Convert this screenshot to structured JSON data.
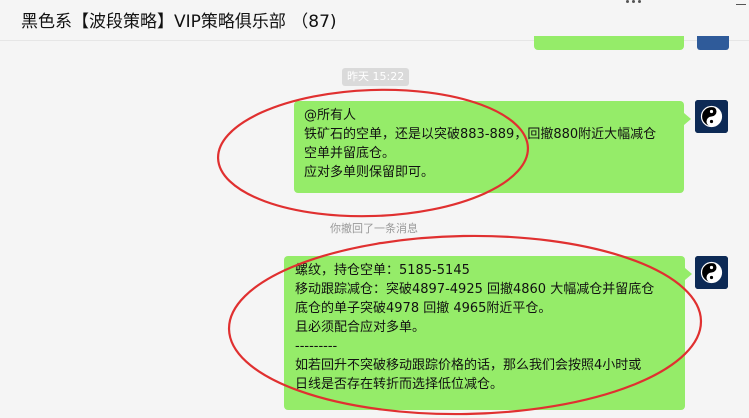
{
  "header": {
    "title": "黑色系【波段策略】VIP策略俱乐部 （87)"
  },
  "timestamp": "昨天 15:22",
  "recall_notice": "你撤回了一条消息",
  "messages": [
    {
      "lines": [
        "@所有人",
        "铁矿石的空单，还是以突破883-889，回撤880附近大幅减仓",
        "空单并留底仓。",
        "应对多单则保留即可。"
      ]
    },
    {
      "lines": [
        "螺纹，持仓空单：5185-5145",
        "移动跟踪减仓：突破4897-4925  回撤4860 大幅减仓并留底仓",
        "底仓的单子突破4978 回撤 4965附近平仓。",
        "且必须配合应对多单。",
        "---------",
        "如若回升不突破移动跟踪价格的话，那么我们会按照4小时或",
        "日线是否存在转折而选择低位减仓。"
      ]
    }
  ],
  "colors": {
    "bubble": "#95ec69",
    "annotation": "#e03030",
    "background": "#f5f5f5"
  },
  "icons": [
    "more-icon",
    "minimize-icon",
    "yin-yang-avatar-icon"
  ]
}
